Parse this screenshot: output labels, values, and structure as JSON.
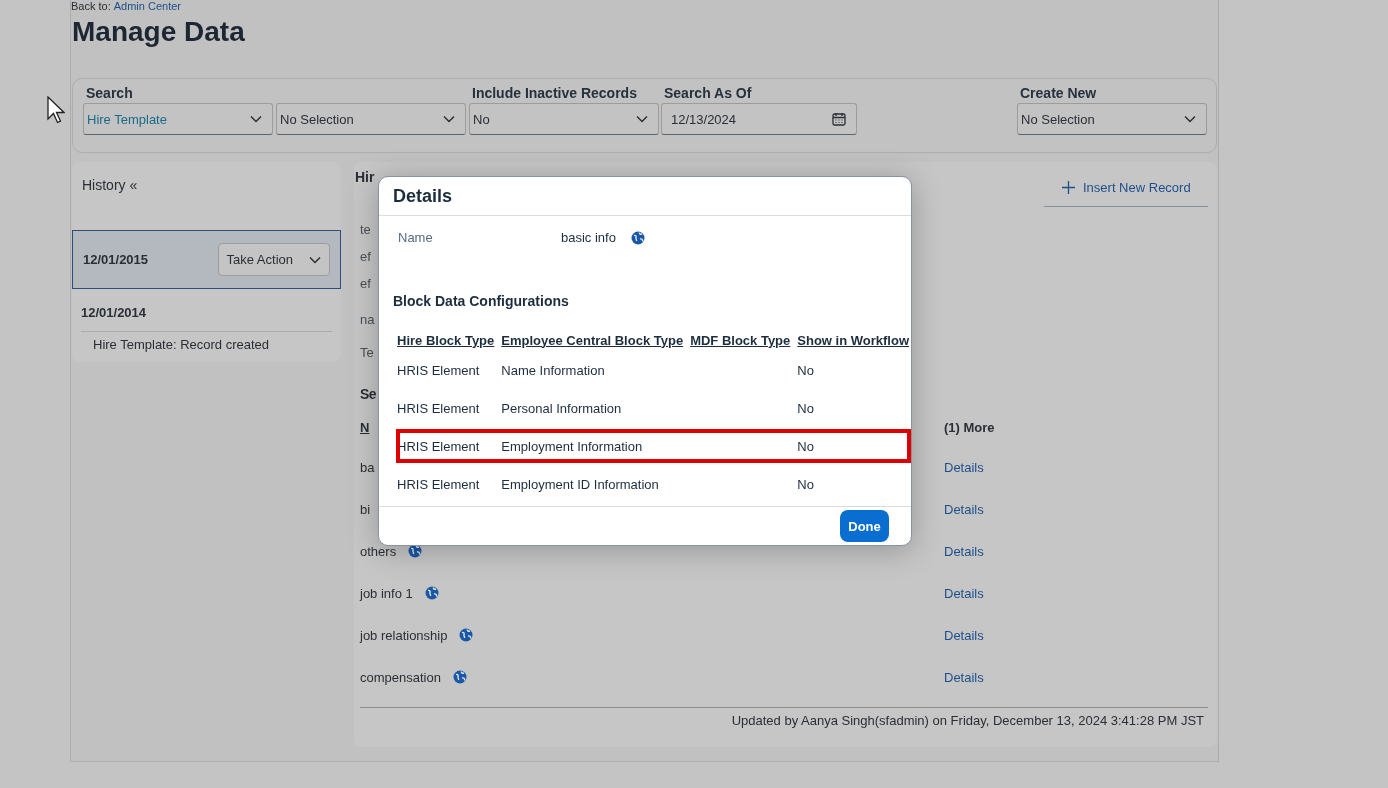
{
  "back_link": {
    "prefix": "Back to:",
    "link": "Admin Center"
  },
  "title": "Manage Data",
  "filters": [
    {
      "label": "Search",
      "fields": [
        {
          "kind": "dropdown",
          "value": "Hire Template",
          "active": true
        },
        {
          "kind": "dropdown",
          "value": "No Selection",
          "active": false
        }
      ]
    },
    {
      "label": "Include Inactive Records",
      "fields": [
        {
          "kind": "dropdown",
          "value": "No",
          "active": false
        }
      ]
    },
    {
      "label": "Search As Of",
      "fields": [
        {
          "kind": "date",
          "value": "12/13/2024",
          "active": false
        }
      ]
    },
    {
      "label": "Create New",
      "fields": [
        {
          "kind": "dropdown",
          "value": "No Selection",
          "active": false
        }
      ]
    }
  ],
  "history": {
    "title": "History",
    "collapse": "«",
    "entries": [
      {
        "date": "12/01/2015",
        "selected": true,
        "action": "Take Action"
      },
      {
        "date": "12/01/2014",
        "selected": false,
        "notes": [
          "Hire Template: Record created"
        ]
      }
    ]
  },
  "record": {
    "heading": "Hir",
    "insert_button": "Insert New Record",
    "fields": [
      "te",
      "ef",
      "ef",
      "na",
      "Te"
    ],
    "section": "Se",
    "column_1": "N",
    "column_2": "(1) More",
    "rows": [
      {
        "name": "ba",
        "globe": false,
        "details": "Details"
      },
      {
        "name": "bi",
        "globe": false,
        "details": "Details"
      },
      {
        "name": "others",
        "globe": true,
        "details": "Details"
      },
      {
        "name": "job info 1",
        "globe": true,
        "details": "Details"
      },
      {
        "name": "job relationship",
        "globe": true,
        "details": "Details"
      },
      {
        "name": "compensation",
        "globe": true,
        "details": "Details"
      }
    ],
    "footer": "Updated by Aanya Singh(sfadmin) on Friday, December 13, 2024 3:41:28 PM JST"
  },
  "dialog": {
    "title": "Details",
    "name_label": "Name",
    "name_value": "basic info",
    "section": "Block Data Configurations",
    "columns": [
      "Hire Block Type",
      "Employee Central Block Type",
      "MDF Block Type",
      "Show in Workflow"
    ],
    "rows": [
      {
        "hire_block_type": "HRIS Element",
        "ec_block_type": "Name Information",
        "show_in_workflow": "No",
        "highlighted": false
      },
      {
        "hire_block_type": "HRIS Element",
        "ec_block_type": "Personal Information",
        "show_in_workflow": "No",
        "highlighted": false
      },
      {
        "hire_block_type": "HRIS Element",
        "ec_block_type": "Employment Information",
        "show_in_workflow": "No",
        "highlighted": true
      },
      {
        "hire_block_type": "HRIS Element",
        "ec_block_type": "Employment ID Information",
        "show_in_workflow": "No",
        "highlighted": false
      }
    ],
    "done_button": "Done"
  }
}
